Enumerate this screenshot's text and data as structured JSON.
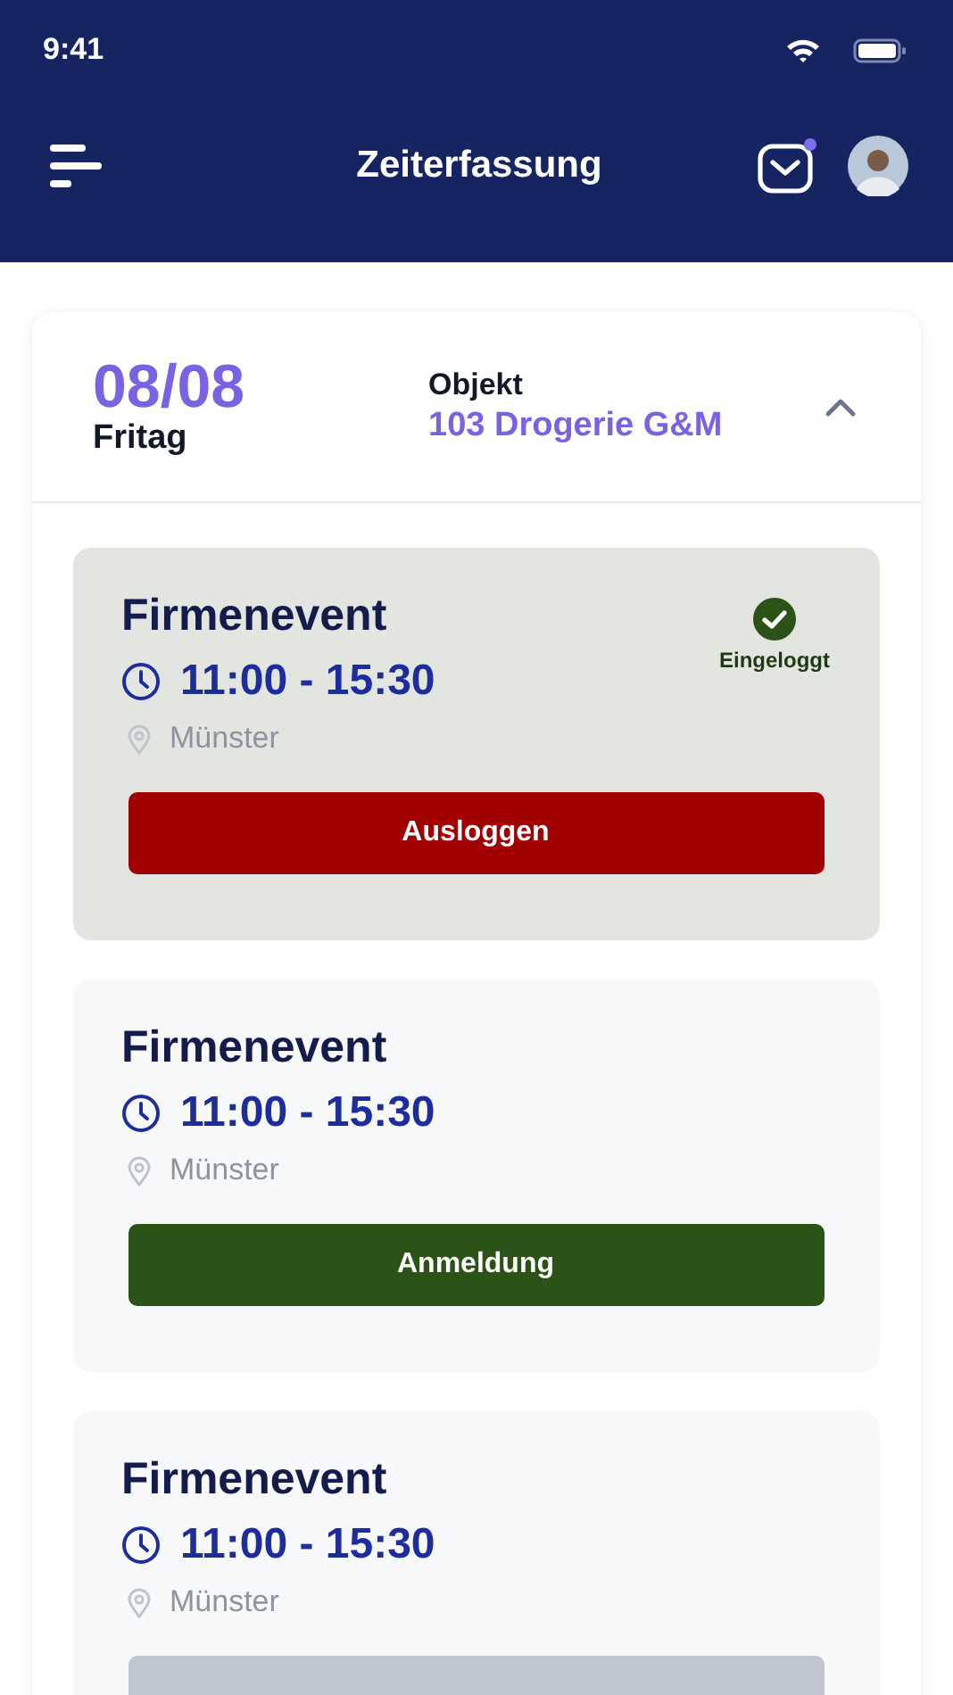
{
  "status_bar": {
    "time": "9:41"
  },
  "nav": {
    "title": "Zeiterfassung",
    "mail_unread": true
  },
  "day": {
    "date": "08/08",
    "weekday": "Fritag",
    "object_label": "Objekt",
    "object_name": "103 Drogerie G&M",
    "expanded": true
  },
  "shifts": [
    {
      "kind": "logged_in",
      "title": "Firmenevent",
      "time": "11:00 - 15:30",
      "location": "Münster",
      "status": "Eingeloggt",
      "button": "Ausloggen"
    },
    {
      "kind": "open",
      "title": "Firmenevent",
      "time": "11:00 - 15:30",
      "location": "Münster",
      "button": "Anmeldung"
    },
    {
      "kind": "disabled",
      "title": "Firmenevent",
      "time": "11:00 - 15:30",
      "location": "Münster"
    }
  ]
}
